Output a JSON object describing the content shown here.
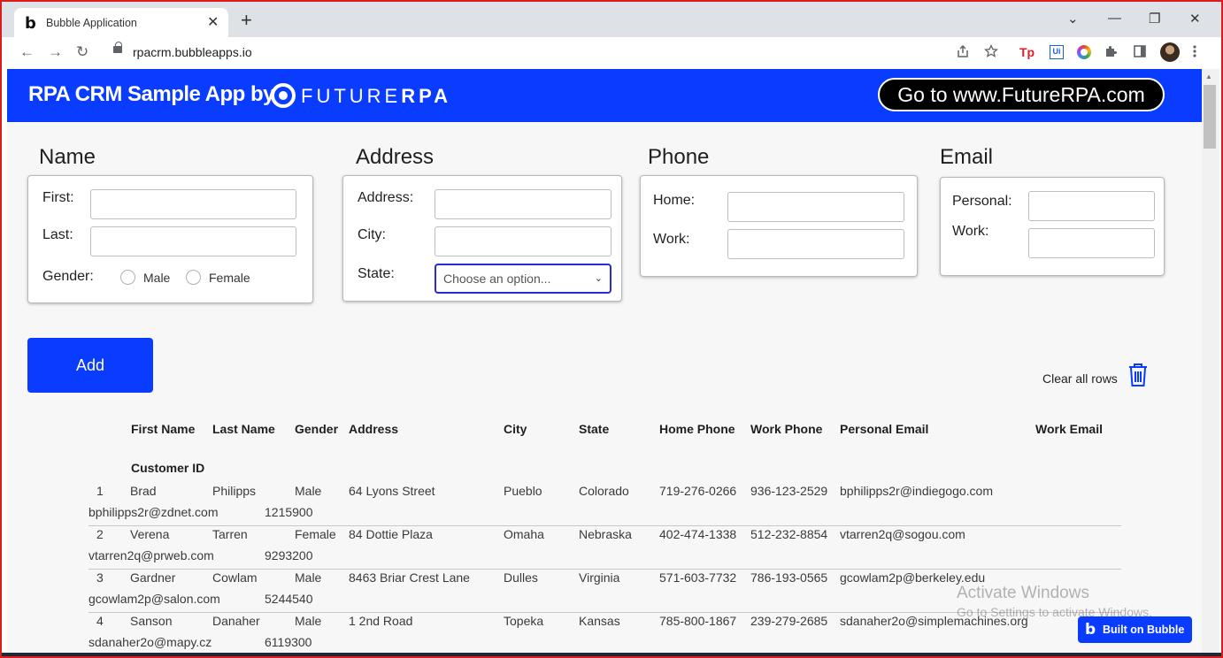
{
  "browser": {
    "tab_title": "Bubble Application",
    "tab_favicon": "b",
    "tab_close": "✕",
    "new_tab": "+",
    "url": "rpacrm.bubbleapps.io",
    "win_controls": {
      "dropdown": "⌄",
      "minimize": "—",
      "restore": "❐",
      "close": "✕"
    },
    "nav": {
      "back": "←",
      "forward": "→",
      "reload": "↻"
    },
    "toolbar_icons": [
      "share-icon",
      "star-icon",
      "tp-extension-icon",
      "uipath-extension-icon",
      "color-extension-icon",
      "puzzle-icon",
      "sidepanel-icon",
      "profile-avatar",
      "kebab-menu-icon"
    ],
    "ext_tp": "Tp",
    "ext_ui": "Ui"
  },
  "banner": {
    "title": "RPA CRM Sample App by",
    "logo_light": "FUTURE",
    "logo_bold": "RPA",
    "goto_button": "Go to www.FutureRPA.com",
    "color": "#0a3cff"
  },
  "name_section": {
    "title": "Name",
    "first_label": "First:",
    "last_label": "Last:",
    "gender_label": "Gender:",
    "options": [
      "Male",
      "Female"
    ]
  },
  "address_section": {
    "title": "Address",
    "address_label": "Address:",
    "city_label": "City:",
    "state_label": "State:",
    "state_placeholder": "Choose an option..."
  },
  "phone_section": {
    "title": "Phone",
    "home_label": "Home:",
    "work_label": "Work:"
  },
  "email_section": {
    "title": "Email",
    "personal_label": "Personal:",
    "work_label": "Work:"
  },
  "actions": {
    "add_button": "Add",
    "clear_rows": "Clear all rows"
  },
  "table": {
    "headers": [
      "First Name",
      "Last Name",
      "Gender",
      "Address",
      "City",
      "State",
      "Home Phone",
      "Work Phone",
      "Personal Email",
      "Work Email"
    ],
    "customer_id_header": "Customer ID",
    "rows": [
      {
        "index": "1",
        "first": "Brad",
        "last": "Philipps",
        "gender": "Male",
        "address": "64 Lyons Street",
        "city": "Pueblo",
        "state": "Colorado",
        "home": "719-276-0266",
        "work": "936-123-2529",
        "personal_email": "bphilipps2r@indiegogo.com",
        "work_email": "bphilipps2r@zdnet.com",
        "customer_id": "1215900"
      },
      {
        "index": "2",
        "first": "Verena",
        "last": "Tarren",
        "gender": "Female",
        "address": "84 Dottie Plaza",
        "city": "Omaha",
        "state": "Nebraska",
        "home": "402-474-1338",
        "work": "512-232-8854",
        "personal_email": "vtarren2q@sogou.com",
        "work_email": "vtarren2q@prweb.com",
        "customer_id": "9293200"
      },
      {
        "index": "3",
        "first": "Gardner",
        "last": "Cowlam",
        "gender": "Male",
        "address": "8463 Briar Crest Lane",
        "city": "Dulles",
        "state": "Virginia",
        "home": "571-603-7732",
        "work": "786-193-0565",
        "personal_email": "gcowlam2p@berkeley.edu",
        "work_email": "gcowlam2p@salon.com",
        "customer_id": "5244540"
      },
      {
        "index": "4",
        "first": "Sanson",
        "last": "Danaher",
        "gender": "Male",
        "address": "1 2nd Road",
        "city": "Topeka",
        "state": "Kansas",
        "home": "785-800-1867",
        "work": "239-279-2685",
        "personal_email": "sdanaher2o@simplemachines.org",
        "work_email": "sdanaher2o@mapy.cz",
        "customer_id": "6119300"
      }
    ]
  },
  "overlay": {
    "watermark_title": "Activate Windows",
    "watermark_sub": "Go to Settings to activate Windows.",
    "bubble_badge": "Built on Bubble"
  }
}
